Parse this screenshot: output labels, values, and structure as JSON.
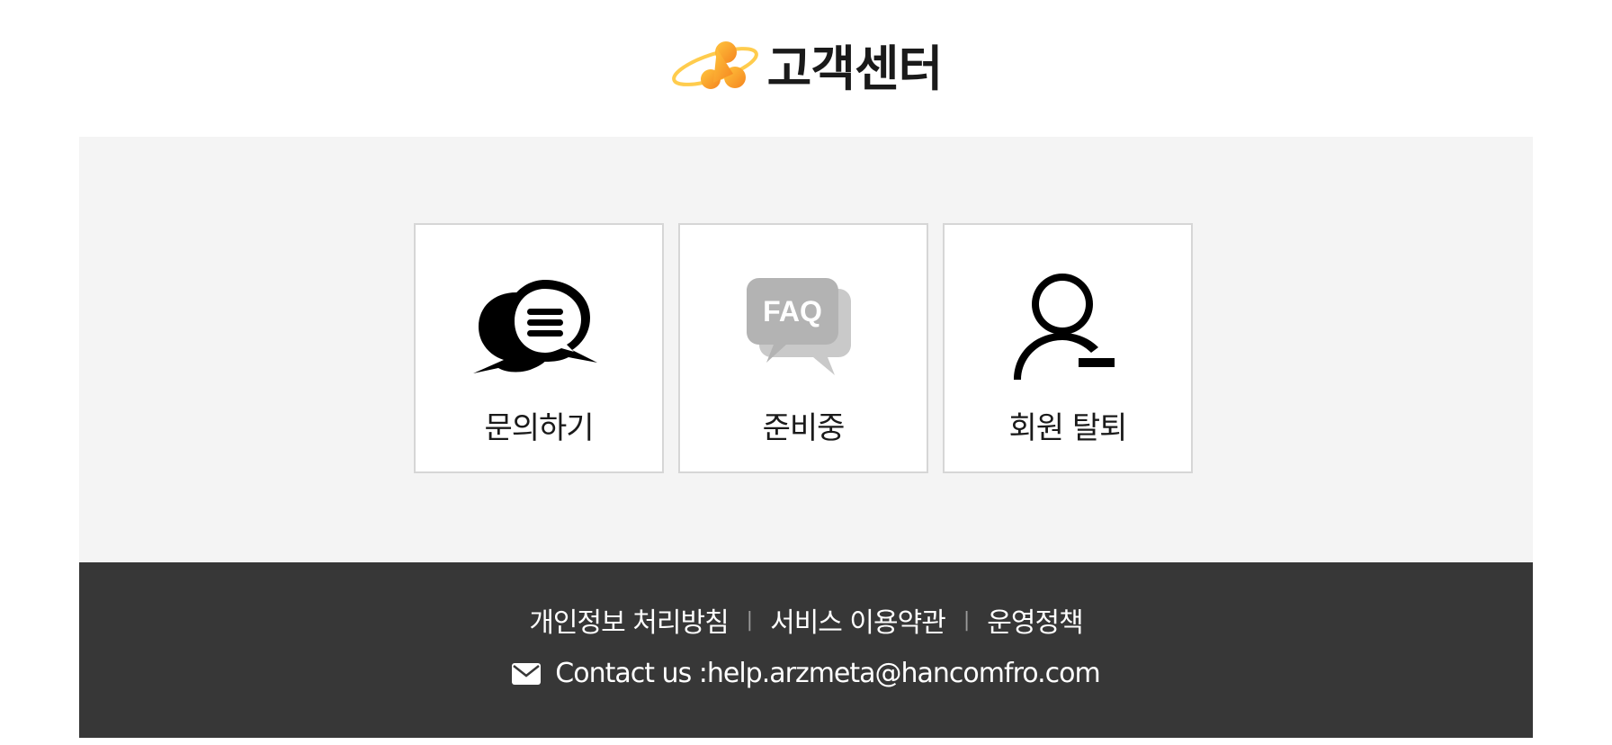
{
  "header": {
    "title": "고객센터",
    "logo_icon": "arzmeta-logo-icon"
  },
  "cards": [
    {
      "label": "문의하기",
      "icon": "chat-bubbles-icon"
    },
    {
      "label": "준비중",
      "icon": "faq-icon",
      "icon_text": "FAQ"
    },
    {
      "label": "회원 탈퇴",
      "icon": "user-remove-icon"
    }
  ],
  "footer": {
    "links": [
      "개인정보 처리방침",
      "서비스 이용약관",
      "운영정책"
    ],
    "separator": "|",
    "contact_label": "Contact us :",
    "contact_email": "help.arzmeta@hancomfro.com",
    "mail_icon": "mail-icon"
  },
  "colors": {
    "band_background": "#f4f4f4",
    "footer_background": "#373737",
    "card_border": "#d6d6d6",
    "logo_orange": "#f59a23",
    "faq_gray": "#b9b9b9"
  }
}
